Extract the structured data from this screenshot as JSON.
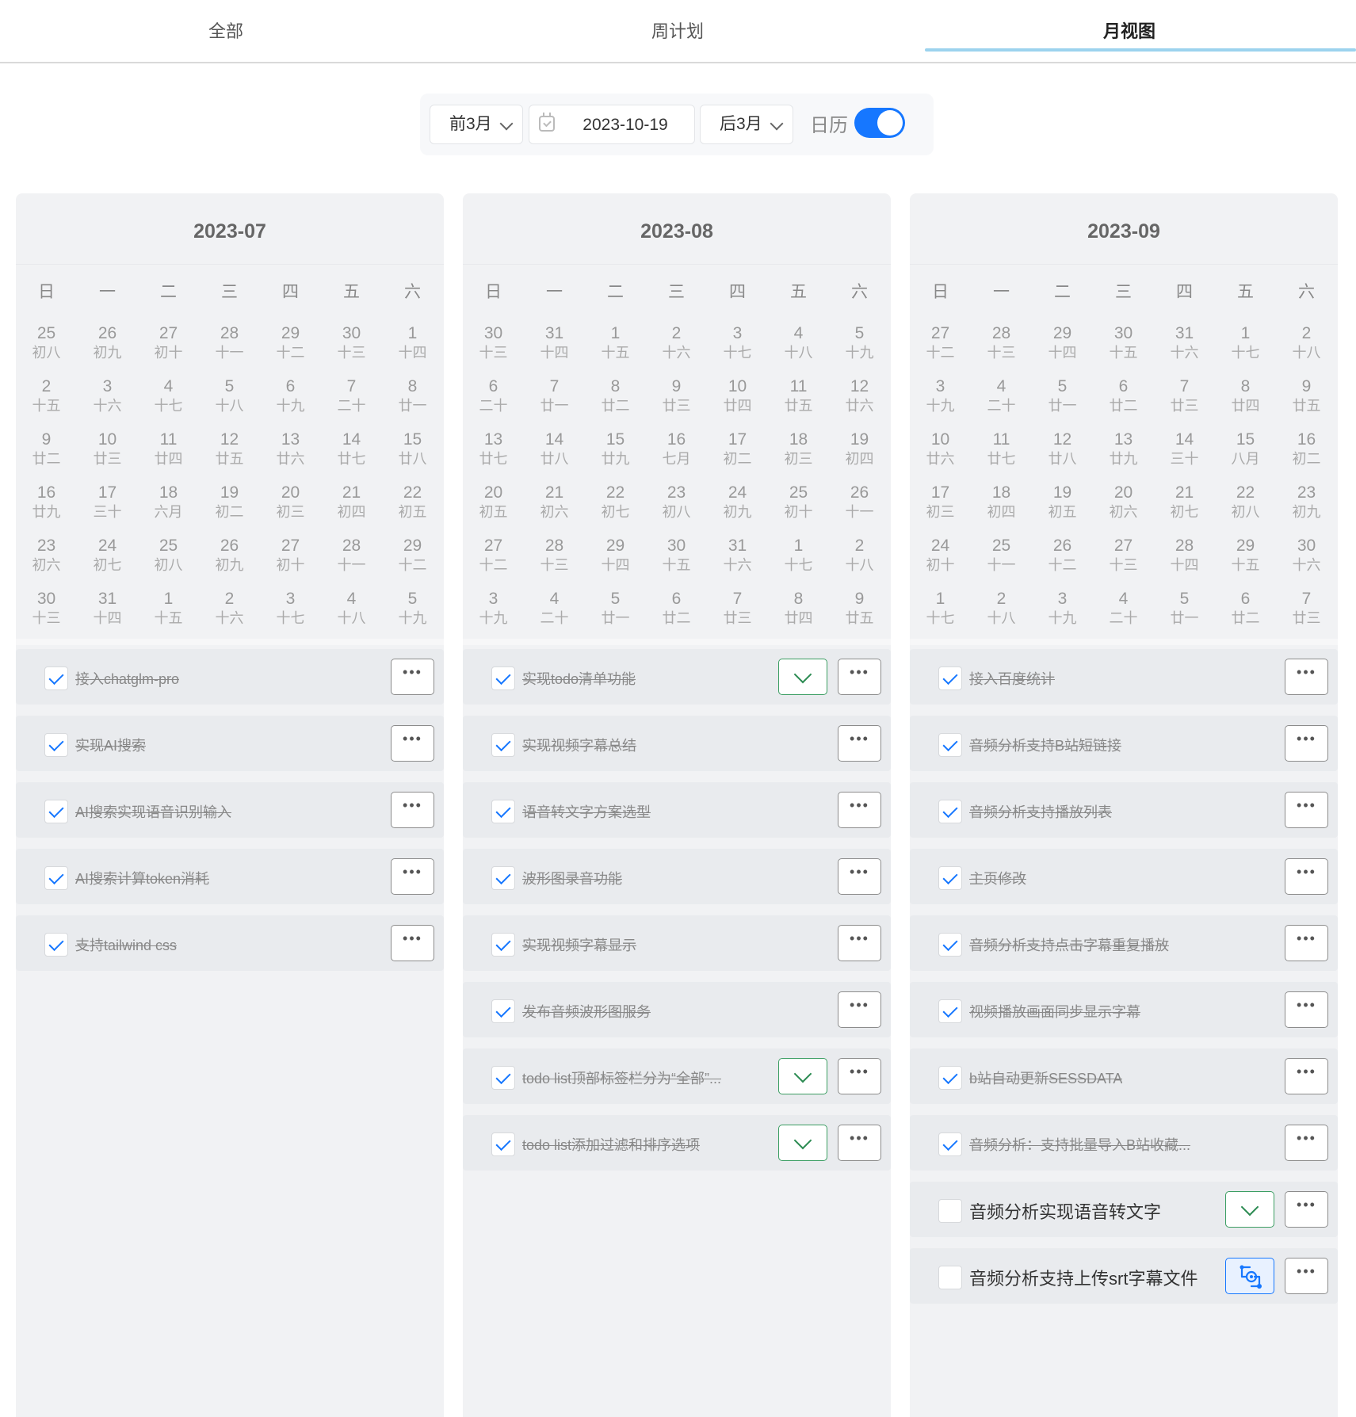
{
  "tabs": [
    {
      "label": "全部",
      "active": false
    },
    {
      "label": "周计划",
      "active": false
    },
    {
      "label": "月视图",
      "active": true
    }
  ],
  "toolbar": {
    "prev_label": "前3月",
    "date_value": "2023-10-19",
    "next_label": "后3月",
    "calendar_label": "日历",
    "calendar_on": true
  },
  "weekdays": [
    "日",
    "一",
    "二",
    "三",
    "四",
    "五",
    "六"
  ],
  "months": [
    {
      "title": "2023-07",
      "days": [
        [
          "25",
          "初八"
        ],
        [
          "26",
          "初九"
        ],
        [
          "27",
          "初十"
        ],
        [
          "28",
          "十一"
        ],
        [
          "29",
          "十二"
        ],
        [
          "30",
          "十三"
        ],
        [
          "1",
          "十四"
        ],
        [
          "2",
          "十五"
        ],
        [
          "3",
          "十六"
        ],
        [
          "4",
          "十七"
        ],
        [
          "5",
          "十八"
        ],
        [
          "6",
          "十九"
        ],
        [
          "7",
          "二十"
        ],
        [
          "8",
          "廿一"
        ],
        [
          "9",
          "廿二"
        ],
        [
          "10",
          "廿三"
        ],
        [
          "11",
          "廿四"
        ],
        [
          "12",
          "廿五"
        ],
        [
          "13",
          "廿六"
        ],
        [
          "14",
          "廿七"
        ],
        [
          "15",
          "廿八"
        ],
        [
          "16",
          "廿九"
        ],
        [
          "17",
          "三十"
        ],
        [
          "18",
          "六月"
        ],
        [
          "19",
          "初二"
        ],
        [
          "20",
          "初三"
        ],
        [
          "21",
          "初四"
        ],
        [
          "22",
          "初五"
        ],
        [
          "23",
          "初六"
        ],
        [
          "24",
          "初七"
        ],
        [
          "25",
          "初八"
        ],
        [
          "26",
          "初九"
        ],
        [
          "27",
          "初十"
        ],
        [
          "28",
          "十一"
        ],
        [
          "29",
          "十二"
        ],
        [
          "30",
          "十三"
        ],
        [
          "31",
          "十四"
        ],
        [
          "1",
          "十五"
        ],
        [
          "2",
          "十六"
        ],
        [
          "3",
          "十七"
        ],
        [
          "4",
          "十八"
        ],
        [
          "5",
          "十九"
        ]
      ],
      "tasks": [
        {
          "text": "接入chatglm-pro",
          "done": true,
          "extra": null
        },
        {
          "text": "实现AI搜索",
          "done": true,
          "extra": null
        },
        {
          "text": "AI搜索实现语音识别输入",
          "done": true,
          "extra": null
        },
        {
          "text": "AI搜索计算token消耗",
          "done": true,
          "extra": null
        },
        {
          "text": "支持tailwind css",
          "done": true,
          "extra": null
        }
      ]
    },
    {
      "title": "2023-08",
      "days": [
        [
          "30",
          "十三"
        ],
        [
          "31",
          "十四"
        ],
        [
          "1",
          "十五"
        ],
        [
          "2",
          "十六"
        ],
        [
          "3",
          "十七"
        ],
        [
          "4",
          "十八"
        ],
        [
          "5",
          "十九"
        ],
        [
          "6",
          "二十"
        ],
        [
          "7",
          "廿一"
        ],
        [
          "8",
          "廿二"
        ],
        [
          "9",
          "廿三"
        ],
        [
          "10",
          "廿四"
        ],
        [
          "11",
          "廿五"
        ],
        [
          "12",
          "廿六"
        ],
        [
          "13",
          "廿七"
        ],
        [
          "14",
          "廿八"
        ],
        [
          "15",
          "廿九"
        ],
        [
          "16",
          "七月"
        ],
        [
          "17",
          "初二"
        ],
        [
          "18",
          "初三"
        ],
        [
          "19",
          "初四"
        ],
        [
          "20",
          "初五"
        ],
        [
          "21",
          "初六"
        ],
        [
          "22",
          "初七"
        ],
        [
          "23",
          "初八"
        ],
        [
          "24",
          "初九"
        ],
        [
          "25",
          "初十"
        ],
        [
          "26",
          "十一"
        ],
        [
          "27",
          "十二"
        ],
        [
          "28",
          "十三"
        ],
        [
          "29",
          "十四"
        ],
        [
          "30",
          "十五"
        ],
        [
          "31",
          "十六"
        ],
        [
          "1",
          "十七"
        ],
        [
          "2",
          "十八"
        ],
        [
          "3",
          "十九"
        ],
        [
          "4",
          "二十"
        ],
        [
          "5",
          "廿一"
        ],
        [
          "6",
          "廿二"
        ],
        [
          "7",
          "廿三"
        ],
        [
          "8",
          "廿四"
        ],
        [
          "9",
          "廿五"
        ]
      ],
      "tasks": [
        {
          "text": "实现todo清单功能",
          "done": true,
          "extra": "expand"
        },
        {
          "text": "实现视频字幕总结",
          "done": true,
          "extra": null
        },
        {
          "text": "语音转文字方案选型",
          "done": true,
          "extra": null
        },
        {
          "text": "波形图录音功能",
          "done": true,
          "extra": null
        },
        {
          "text": "实现视频字幕显示",
          "done": true,
          "extra": null
        },
        {
          "text": "发布音频波形图服务",
          "done": true,
          "extra": null
        },
        {
          "text": "todo list顶部标签栏分为“全部”...",
          "done": true,
          "extra": "expand"
        },
        {
          "text": "todo list添加过滤和排序选项",
          "done": true,
          "extra": "expand"
        }
      ]
    },
    {
      "title": "2023-09",
      "days": [
        [
          "27",
          "十二"
        ],
        [
          "28",
          "十三"
        ],
        [
          "29",
          "十四"
        ],
        [
          "30",
          "十五"
        ],
        [
          "31",
          "十六"
        ],
        [
          "1",
          "十七"
        ],
        [
          "2",
          "十八"
        ],
        [
          "3",
          "十九"
        ],
        [
          "4",
          "二十"
        ],
        [
          "5",
          "廿一"
        ],
        [
          "6",
          "廿二"
        ],
        [
          "7",
          "廿三"
        ],
        [
          "8",
          "廿四"
        ],
        [
          "9",
          "廿五"
        ],
        [
          "10",
          "廿六"
        ],
        [
          "11",
          "廿七"
        ],
        [
          "12",
          "廿八"
        ],
        [
          "13",
          "廿九"
        ],
        [
          "14",
          "三十"
        ],
        [
          "15",
          "八月"
        ],
        [
          "16",
          "初二"
        ],
        [
          "17",
          "初三"
        ],
        [
          "18",
          "初四"
        ],
        [
          "19",
          "初五"
        ],
        [
          "20",
          "初六"
        ],
        [
          "21",
          "初七"
        ],
        [
          "22",
          "初八"
        ],
        [
          "23",
          "初九"
        ],
        [
          "24",
          "初十"
        ],
        [
          "25",
          "十一"
        ],
        [
          "26",
          "十二"
        ],
        [
          "27",
          "十三"
        ],
        [
          "28",
          "十四"
        ],
        [
          "29",
          "十五"
        ],
        [
          "30",
          "十六"
        ],
        [
          "1",
          "十七"
        ],
        [
          "2",
          "十八"
        ],
        [
          "3",
          "十九"
        ],
        [
          "4",
          "二十"
        ],
        [
          "5",
          "廿一"
        ],
        [
          "6",
          "廿二"
        ],
        [
          "7",
          "廿三"
        ]
      ],
      "tasks": [
        {
          "text": "接入百度统计",
          "done": true,
          "extra": null
        },
        {
          "text": "音频分析支持B站短链接",
          "done": true,
          "extra": null
        },
        {
          "text": "音频分析支持播放列表",
          "done": true,
          "extra": null
        },
        {
          "text": "主页修改",
          "done": true,
          "extra": null
        },
        {
          "text": "音频分析支持点击字幕重复播放",
          "done": true,
          "extra": null
        },
        {
          "text": "视频播放画面同步显示字幕",
          "done": true,
          "extra": null
        },
        {
          "text": "b站自动更新SESSDATA",
          "done": true,
          "extra": null
        },
        {
          "text": "音频分析：支持批量导入B站收藏...",
          "done": true,
          "extra": null
        },
        {
          "text": "音频分析实现语音转文字",
          "done": false,
          "extra": "expand"
        },
        {
          "text": "音频分析支持上传srt字幕文件",
          "done": false,
          "extra": "ai"
        }
      ]
    }
  ],
  "icons": {
    "more": "more-dots-icon",
    "expand": "chevron-down-icon",
    "ai": "ai-settings-icon",
    "check": "check-icon",
    "calendar": "calendar-icon"
  },
  "colors": {
    "accent": "#1677ff",
    "tab_ink": "#9cd3ee",
    "expand": "#2c8b52",
    "panel": "#f1f2f4",
    "task": "#e9ebee"
  }
}
